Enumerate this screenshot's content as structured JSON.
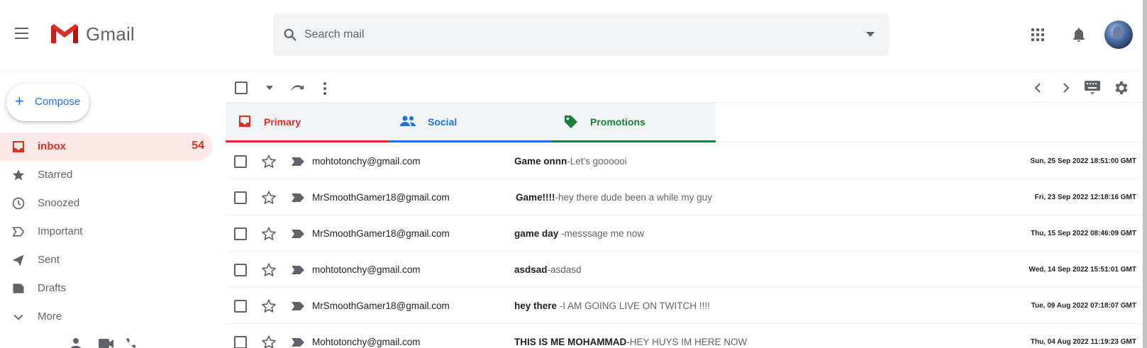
{
  "header": {
    "logo_text": "Gmail",
    "search_placeholder": "Search mail"
  },
  "sidebar": {
    "compose_label": "Compose",
    "items": [
      {
        "label": "inbox",
        "count": "54",
        "icon": "inbox-icon",
        "active": true
      },
      {
        "label": "Starred",
        "icon": "star-icon"
      },
      {
        "label": "Snoozed",
        "icon": "clock-icon"
      },
      {
        "label": "Important",
        "icon": "important-icon"
      },
      {
        "label": "Sent",
        "icon": "send-icon"
      },
      {
        "label": "Drafts",
        "icon": "draft-icon"
      },
      {
        "label": "More",
        "icon": "chevron-down-icon"
      }
    ]
  },
  "tabs": [
    {
      "label": "Primary",
      "icon": "inbox-tab-icon",
      "color": "#d93025"
    },
    {
      "label": "Social",
      "icon": "people-icon",
      "color": "#1a73e8"
    },
    {
      "label": "Promotions",
      "icon": "tag-icon",
      "color": "#188038"
    }
  ],
  "emails": [
    {
      "sender": "mohtotonchy@gmail.com",
      "subject": "Game onnn",
      "snippet": "-Let's goooooi",
      "date": "Sun, 25 Sep 2022 18:51:00 GMT"
    },
    {
      "sender": "MrSmoothGamer18@gmail.com",
      "subject": "Game!!!!",
      "snippet": "-hey there dude been a while my guy",
      "date": "Fri, 23 Sep 2022 12:18:16 GMT"
    },
    {
      "sender": "MrSmoothGamer18@gmail.com",
      "subject": "game day ",
      "snippet": "-messsage me now",
      "date": "Thu, 15 Sep 2022 08:46:09 GMT"
    },
    {
      "sender": "mohtotonchy@gmail.com",
      "subject": "asdsad",
      "snippet": "-asdasd",
      "date": "Wed, 14 Sep 2022 15:51:01 GMT"
    },
    {
      "sender": "MrSmoothGamer18@gmail.com",
      "subject": "hey there ",
      "snippet": "-I AM GOING LIVE ON TWITCH !!!!",
      "date": "Tue, 09 Aug 2022 07:18:07 GMT"
    },
    {
      "sender": "Mohtotonchy@gmail.com",
      "subject": "THIS IS ME MOHAMMAD",
      "snippet": "-HEY HUYS IM HERE NOW",
      "date": "Thu, 04 Aug 2022 11:19:23 GMT"
    }
  ]
}
